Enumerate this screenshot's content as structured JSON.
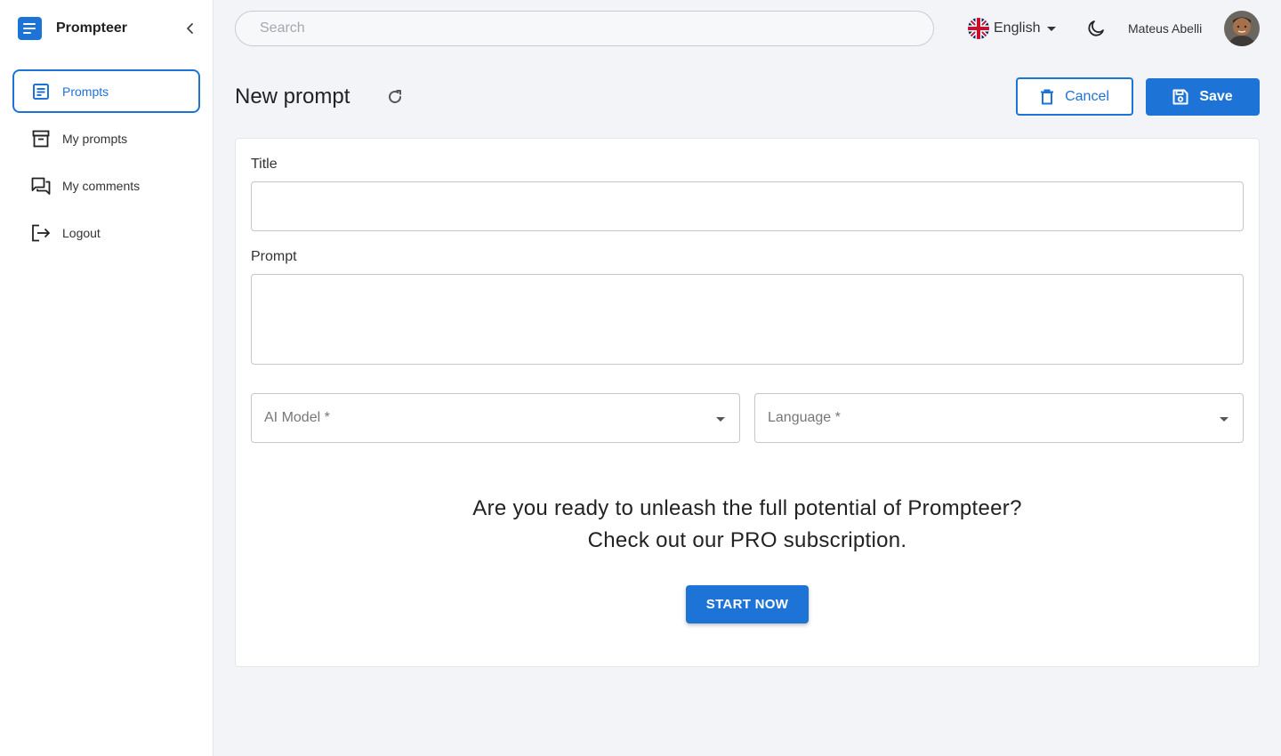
{
  "app": {
    "name": "Prompteer"
  },
  "sidebar": {
    "items": [
      {
        "label": "Prompts",
        "icon": "document-icon",
        "active": true
      },
      {
        "label": "My prompts",
        "icon": "archive-icon",
        "active": false
      },
      {
        "label": "My comments",
        "icon": "chat-icon",
        "active": false
      },
      {
        "label": "Logout",
        "icon": "logout-icon",
        "active": false
      }
    ]
  },
  "topbar": {
    "search_placeholder": "Search",
    "language": "English",
    "user_name": "Mateus Abelli"
  },
  "header": {
    "title": "New prompt",
    "cancel_label": "Cancel",
    "save_label": "Save"
  },
  "form": {
    "title_label": "Title",
    "title_value": "",
    "prompt_label": "Prompt",
    "prompt_value": "",
    "ai_model_label": "AI Model *",
    "language_label": "Language *"
  },
  "promo": {
    "line1": "Are you ready to unleash the full potential of Prompteer?",
    "line2": "Check out our PRO subscription.",
    "cta_label": "START NOW"
  },
  "colors": {
    "primary": "#1e73d6",
    "background": "#f2f4f8"
  }
}
